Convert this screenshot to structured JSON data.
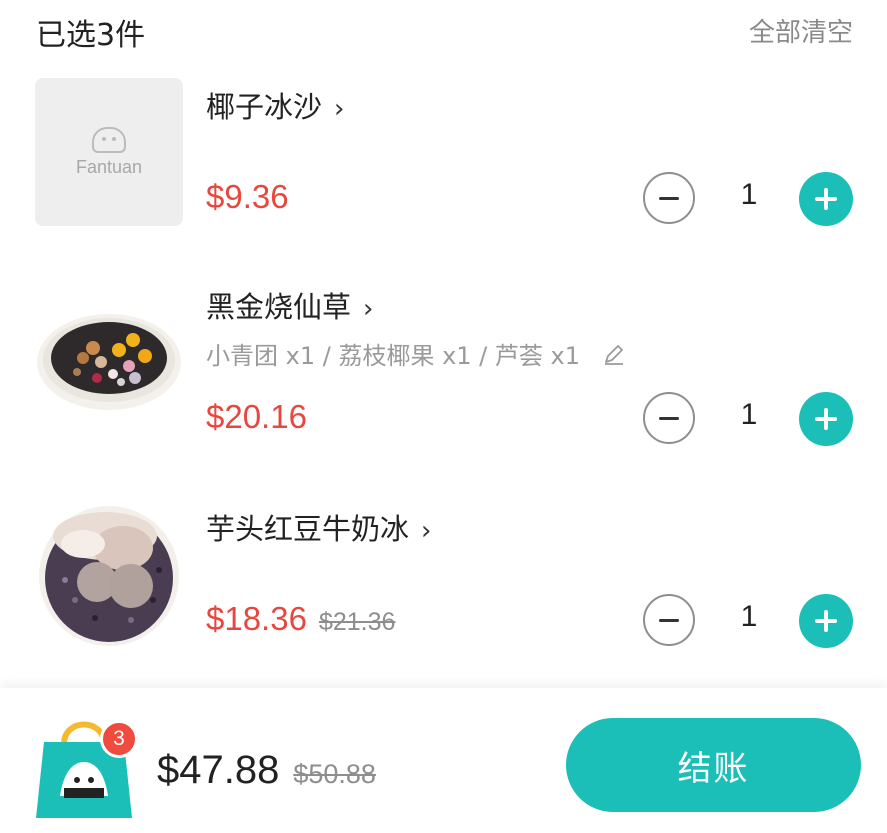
{
  "header": {
    "selected_label": "已选3件",
    "clear_label": "全部清空"
  },
  "items": [
    {
      "name": "椰子冰沙",
      "placeholder_text": "Fantuan",
      "price": "$9.36",
      "quantity": "1"
    },
    {
      "name": "黑金烧仙草",
      "options": "小青团 x1 / 荔枝椰果 x1 / 芦荟 x1",
      "price": "$20.16",
      "quantity": "1"
    },
    {
      "name": "芋头红豆牛奶冰",
      "price": "$18.36",
      "original_price": "$21.36",
      "quantity": "1"
    }
  ],
  "footer": {
    "badge_count": "3",
    "total": "$47.88",
    "total_original": "$50.88",
    "checkout_label": "结账"
  },
  "colors": {
    "accent": "#1cbfb7",
    "price_red": "#e8473f",
    "badge_red": "#ef4b3f"
  }
}
